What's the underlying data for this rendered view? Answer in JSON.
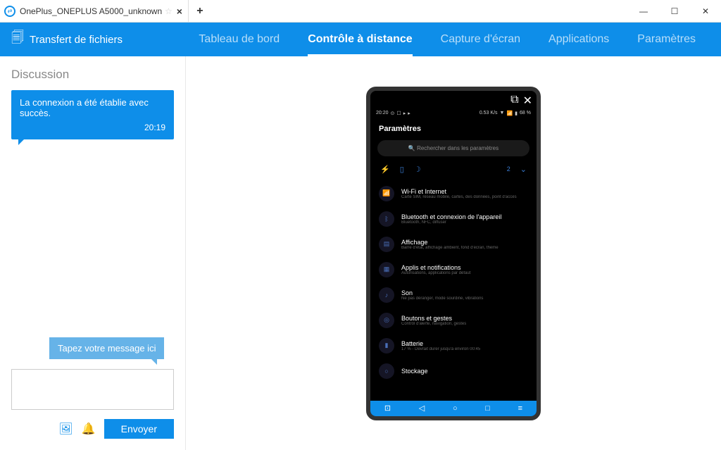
{
  "window": {
    "tab_title": "OnePlus_ONEPLUS A5000_unknown"
  },
  "toolbar": {
    "file_transfer": "Transfert de fichiers",
    "tabs": [
      "Tableau de bord",
      "Contrôle à distance",
      "Capture d'écran",
      "Applications",
      "Paramètres"
    ],
    "active_index": 1
  },
  "chat": {
    "title": "Discussion",
    "message": {
      "text": "La connexion a été établie avec succès.",
      "time": "20:19"
    },
    "compose_hint": "Tapez votre message ici",
    "send": "Envoyer"
  },
  "phone": {
    "status": {
      "time": "20:20",
      "rate": "0.53 K/s",
      "battery": "68 %"
    },
    "title": "Paramètres",
    "search_placeholder": "Rechercher dans les paramètres",
    "quick_badge": "2",
    "items": [
      {
        "icon": "📶",
        "title": "Wi-Fi et Internet",
        "sub": "Carte SIM, réseau mobile, cartes, des données, point d'accès"
      },
      {
        "icon": "ᛒ",
        "title": "Bluetooth et connexion de l'appareil",
        "sub": "Bluetooth, NFC, diffuser"
      },
      {
        "icon": "▤",
        "title": "Affichage",
        "sub": "Barre d'état, affichage ambient, fond d'écran, thème"
      },
      {
        "icon": "▦",
        "title": "Applis et notifications",
        "sub": "Autorisations, applications par défaut"
      },
      {
        "icon": "♪",
        "title": "Son",
        "sub": "Ne pas déranger, mode sourdine, vibrations"
      },
      {
        "icon": "◎",
        "title": "Boutons et gestes",
        "sub": "Contrôl d'alerte, navigation, gestes"
      },
      {
        "icon": "▮",
        "title": "Batterie",
        "sub": "17 % - Devrait durer jusqu'à environ 00:45"
      },
      {
        "icon": "○",
        "title": "Stockage",
        "sub": ""
      }
    ]
  }
}
